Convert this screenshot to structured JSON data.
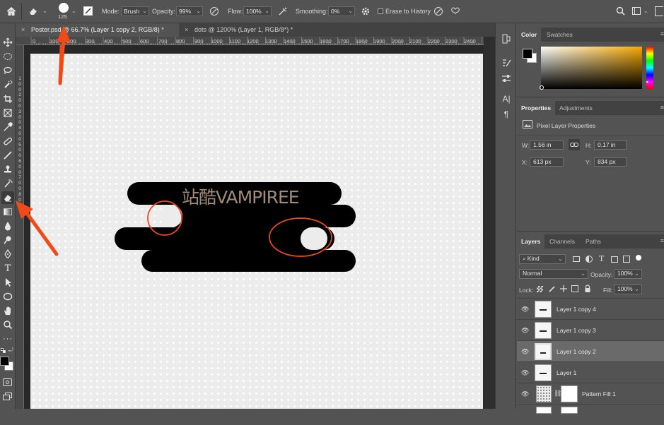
{
  "options_bar": {
    "brush_size": "125",
    "mode_label": "Mode:",
    "mode_value": "Brush",
    "opacity_label": "Opacity:",
    "opacity_value": "99%",
    "flow_label": "Flow:",
    "flow_value": "100%",
    "smoothing_label": "Smoothing:",
    "smoothing_value": "0%",
    "erase_to_history_label": "Erase to History"
  },
  "tabs": [
    {
      "label": "Poster.psd @ 66.7% (Layer 1 copy 2, RGB/8) *"
    },
    {
      "label": "dots @ 1200% (Layer 1, RGB/8*) *"
    }
  ],
  "ruler_ticks": [
    "0",
    "100",
    "200",
    "300",
    "400",
    "500",
    "600",
    "700",
    "800",
    "900",
    "1000",
    "1100",
    "1200",
    "1300",
    "1400",
    "1500",
    "1600",
    "1700",
    "1800",
    "1900",
    "2000",
    "2100",
    "2200",
    "2300",
    "2400"
  ],
  "ruler_v_ticks": [
    "1",
    "0",
    "0",
    "2",
    "0",
    "0",
    "3",
    "0",
    "0",
    "4",
    "0",
    "0",
    "5",
    "0",
    "0",
    "6",
    "0",
    "0",
    "7",
    "0",
    "0",
    "8",
    "0",
    "0"
  ],
  "canvas": {
    "artwork_text": "站酷VAMPIREE",
    "text_color": "#a08a78",
    "bar_color": "#000000",
    "annotation_color": "#f04a18"
  },
  "color_panel": {
    "tabs": [
      "Color",
      "Swatches"
    ]
  },
  "properties_panel": {
    "tabs": [
      "Properties",
      "Adjustments"
    ],
    "section_title": "Pixel Layer Properties",
    "w_label": "W:",
    "w_value": "1.56 in",
    "h_label": "H:",
    "h_value": "0.17 in",
    "x_label": "X:",
    "x_value": "613 px",
    "y_label": "Y:",
    "y_value": "834 px"
  },
  "layers_panel": {
    "tabs": [
      "Layers",
      "Channels",
      "Paths"
    ],
    "kind_label": "Kind",
    "blend_mode": "Normal",
    "opacity_label": "Opacity:",
    "opacity_value": "100%",
    "lock_label": "Lock:",
    "fill_label": "Fill:",
    "fill_value": "100%",
    "layers": [
      {
        "name": "Layer 1 copy 4",
        "selected": false
      },
      {
        "name": "Layer 1 copy 3",
        "selected": false
      },
      {
        "name": "Layer 1 copy 2",
        "selected": true
      },
      {
        "name": "Layer 1",
        "selected": false
      },
      {
        "name": "Pattern Fill 1",
        "selected": false
      }
    ]
  }
}
